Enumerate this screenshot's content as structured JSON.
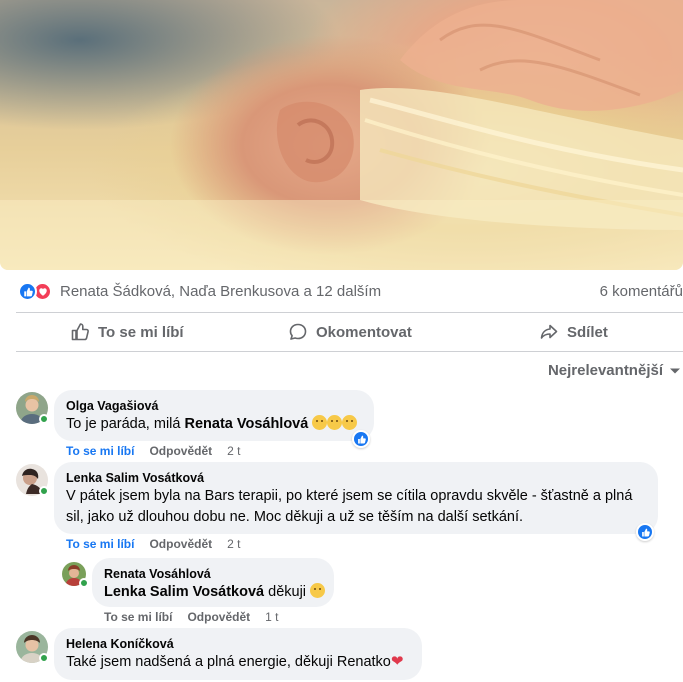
{
  "reactions": {
    "names": "Renata Šádková, Naďa Brenkusova a 12 dalším",
    "comments_count": "6 komentářů",
    "icons": [
      "like-icon",
      "love-icon"
    ]
  },
  "actions": {
    "like": "To se mi líbí",
    "comment": "Okomentovat",
    "share": "Sdílet"
  },
  "sort_label": "Nejrelevantnější",
  "comments": [
    {
      "author": "Olga Vagašiová",
      "text_before": "To je paráda, milá ",
      "mention": "Renata Vosáhlová",
      "emojis": [
        "slightly-smiling-face",
        "slightly-smiling-face",
        "slightly-smiling-face"
      ],
      "like": "To se mi líbí",
      "reply": "Odpovědět",
      "time": "2 t"
    },
    {
      "author": "Lenka Salim Vosátková",
      "text": "V pátek jsem byla na Bars terapii, po které jsem se cítila opravdu skvěle - šťastně a plná sil, jako už dlouhou dobu ne. Moc děkuji a už se těším na další setkání.",
      "like": "To se mi líbí",
      "reply": "Odpovědět",
      "time": "2 t"
    },
    {
      "author": "Renata Vosáhlová",
      "mention": "Lenka Salim Vosátková",
      "text_after": " děkuji",
      "emoji": "smiling-face",
      "like": "To se mi líbí",
      "reply": "Odpovědět",
      "time": "1 t"
    },
    {
      "author": "Helena Koníčková",
      "text": "Také jsem nadšená a plná energie, děkuji Renatko",
      "emoji": "heart"
    }
  ],
  "colors": {
    "accent": "#1877f2",
    "love": "#f33e58",
    "secondary_text": "#65676b",
    "bubble_bg": "#f0f2f5",
    "online": "#31a24c"
  }
}
